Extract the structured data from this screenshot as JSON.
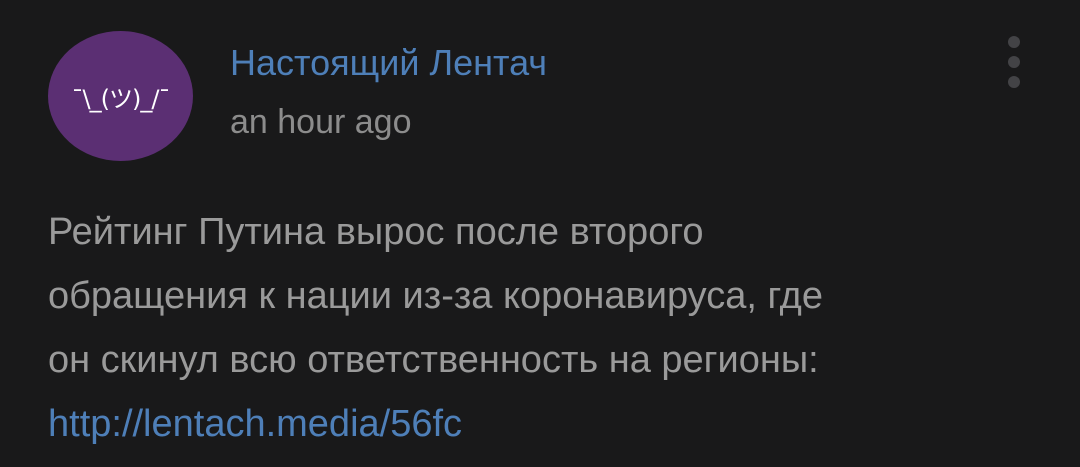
{
  "post": {
    "avatar_text": "¯\\_(ツ)_/¯",
    "author": "Настоящий Лентач",
    "time": "an hour ago",
    "more_icon": "more-vertical-icon",
    "text_lines": [
      "Рейтинг Путина вырос после второго",
      "обращения к нации из-за коронавируса, где",
      "он скинул всю ответственность на регионы:"
    ],
    "link": "http://lentach.media/56fc"
  },
  "colors": {
    "background": "#19191a",
    "avatar": "#5b2f73",
    "author": "#4e7fb8",
    "link": "#4e7fb8",
    "text": "#9a9a9a",
    "time": "#8c8c8c"
  }
}
